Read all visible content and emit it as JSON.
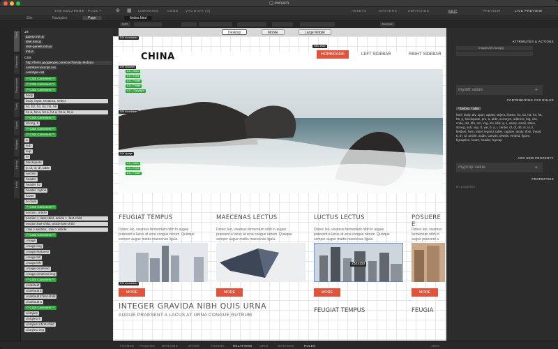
{
  "window": {
    "title": "ewnach"
  },
  "toolbar": {
    "project": "THE ESCAPERS : PLUS ?",
    "libraries": "LIBRARIES",
    "code": "CODE",
    "validate": "VALIDATE (0)",
    "assets": "ASSETS",
    "masters": "MASTERS",
    "swatches": "SWATCHES",
    "edit": "EDIT",
    "preview": "PREVIEW",
    "live_preview": "LIVE PREVIEW"
  },
  "bar2": {
    "site": "Site",
    "navigator": "Navigator",
    "page_tab": "Page",
    "file_tab": "/index.html"
  },
  "bar3": {
    "chip1": "IMG",
    "chip2": "Normal"
  },
  "devices": {
    "desktop": "Desktop",
    "mobile": "Mobile",
    "large_mobile": "Large Mobile"
  },
  "vtabs": [
    "Files",
    "Elements",
    "Responsive",
    "Tools",
    "Styles",
    "Widgets",
    "Library",
    "Hello"
  ],
  "leftpanel": {
    "js_head": "JS",
    "js_files": [
      "jquery.min.js",
      "skel.min.js",
      "skel-panels.min.js",
      "init.js"
    ],
    "css_head": "CSS",
    "css_files": [
      "http://fonts.googleapis.com/css?family=Roboto",
      "css/skel-noscript.css",
      "css/style.css"
    ],
    "rules": [
      "/* CSS Comment */",
      "/* CSS Comment */",
      "/* CSS Comment */",
      "body",
      "body, input, textarea, select",
      "h1, h2, h3, h4, h5, h6",
      "h1 a, h2 a, h3 a, h4 a, h5 a, h6 a",
      "/* CSS Comment */",
      "strong, b",
      "/* CSS Comment */",
      "/* CSS Comment */",
      "a",
      "sub",
      "sup",
      "hr",
      "blockquote",
      "p, ul, ol, dl, table",
      "section",
      "header",
      "header h2",
      "header .byline",
      "footer",
      "br.clear",
      "/* CSS Comment */",
      "section, article",
      "section > :last-child, article > :last-child",
      "section:last-child, article:last-child",
      ".row > section, .row > article",
      "/* CSS Comment */",
      ".image",
      ".image img",
      ".image.featured",
      ".image.full",
      ".image.left",
      ".image.centered",
      ".image.centered img",
      "/* CSS Comment */",
      "ul.default",
      "ul.default li",
      "ul.default li:first-child",
      "ul.default a",
      "/* CSS Comment */",
      "ul.style1",
      "ul.style1 li",
      "ul.style1 li:first-child",
      "ul.style1 img"
    ]
  },
  "canvas": {
    "logo": "CHINA",
    "nav": [
      "HOMEPAGE",
      "LEFT SIDEBAR",
      "RIGHT SIDEBAR"
    ],
    "tags": {
      "div_container": "DIV #container",
      "div_banner": "DIV #banner",
      "nav_nav": "NAV #nav",
      "div_page": "DIV #page",
      "img_size": "282x150"
    },
    "green_tags": [
      "a.li-- Main",
      "a.li-- Extra",
      "a.li-- Footer",
      "a.li-- Footer",
      "a.li-- Copyright",
      "a.li-- Main",
      "a.li-- Extra",
      "a.li-- Footer"
    ],
    "columns": [
      {
        "title": "FEUGIAT TEMPUS",
        "text": "Donec leo, vivamus fermentum nibh in augue praesent a lacus at urna congue rutrum. Quisque semper augue mattis maecenas ligula."
      },
      {
        "title": "MAECENAS LECTUS",
        "text": "Donec leo, vivamus fermentum nibh in augue praesent a lacus at urna congue rutrum. Quisque semper augue mattis maecenas ligula."
      },
      {
        "title": "LUCTUS LECTUS",
        "text": "Donec leo, vivamus fermentum nibh in augue praesent a lacus at urna congue rutrum. Quisque semper augue mattis maecenas ligula."
      },
      {
        "title": "POSUERE E",
        "text": "Donec leo, vivamus fermentum nibh in augue praesent a lacus at urna congue rutrum. Quisque semper augue mattis maecenas ligula."
      }
    ],
    "more_label": "MORE",
    "big_title": "INTEGER GRAVIDA NIBH QUIS URNA",
    "big_sub": "AUGUE PRAESENT A LACUS AT URNA CONGUE RUTRUM",
    "small_title": "FEUGIAT TEMPUS",
    "small_title2": "FEUGIA"
  },
  "rightpanel": {
    "attributes_head": "ATTRIBUTES & ACTIONS",
    "attr_value": "images/pics10.jpg",
    "attr_placeholder": "myattr.value",
    "contributing_head": "CONTRIBUTING CSS RULES",
    "rule_selector": "*:before, *:after",
    "rule_list": "html, body, div, span, applet, object, iframe, h1, h2, h3, h4, h5, h6, p, blockquote, pre, a, abbr, acronym, address, big, cite, code, del, dfn, em, img, ins, kbd, q, s, samp, small, strike, strong, sub, sup, tt, var, b, u, i, center, dl, dt, dd, ol, ul, li, fieldset, form, label, legend, table, caption, tbody, tfoot, thead, tr, th, td, article, aside, canvas, details, embed, figure, figcaption, footer, header, hgroup",
    "add_property_head": "ADD NEW PROPERTY",
    "prop_placeholder": "myprop.value",
    "properties_head": "PROPERTIES",
    "no_properties": "No properties"
  },
  "statusbar": [
    "FRAMES",
    "PADDING",
    "MARGINS",
    "SPANS",
    "TOKENS",
    "RELATIONS",
    "GRID",
    "MASTERS",
    "RULES"
  ],
  "zoom": "100%"
}
